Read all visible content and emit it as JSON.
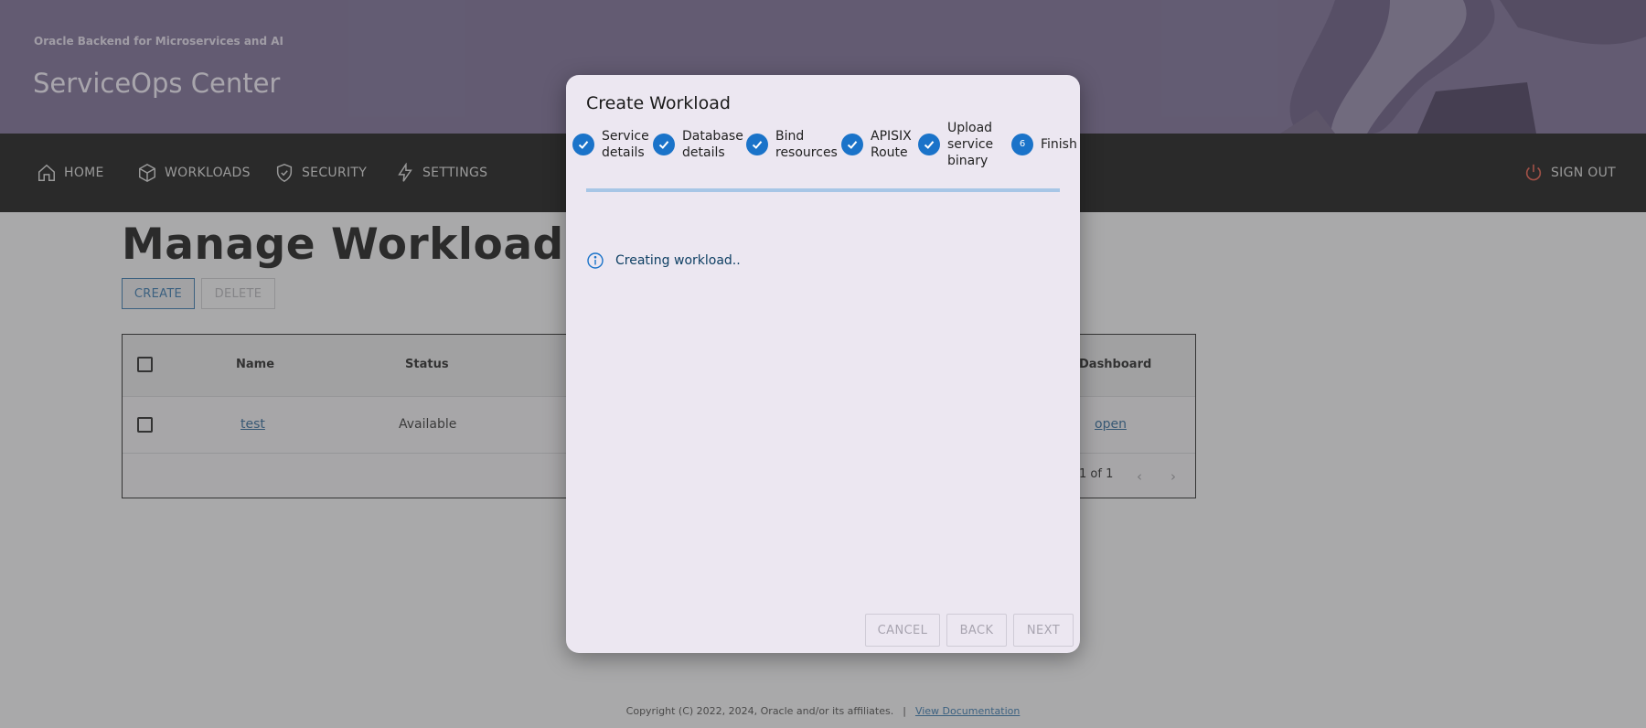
{
  "header": {
    "subtitle": "Oracle Backend for Microservices and AI",
    "title": "ServiceOps Center"
  },
  "nav": {
    "home": "HOME",
    "workloads": "WORKLOADS",
    "security": "SECURITY",
    "settings": "SETTINGS",
    "sign_out": "SIGN OUT"
  },
  "main": {
    "page_title": "Manage Workloads",
    "create_label": "CREATE",
    "delete_label": "DELETE",
    "table": {
      "headers": {
        "name": "Name",
        "status": "Status",
        "dashboard": "Dashboard"
      },
      "rows": [
        {
          "name": "test",
          "status": "Available",
          "dashboard": "open"
        }
      ],
      "pager": "1 of 1"
    }
  },
  "footer": {
    "copyright": "Copyright (C) 2022, 2024, Oracle and/or its affiliates.",
    "separator": "|",
    "doc_link": "View Documentation"
  },
  "dialog": {
    "title": "Create Workload",
    "steps": [
      {
        "line1": "Service",
        "line2": "details",
        "line3": "",
        "done": true
      },
      {
        "line1": "Database",
        "line2": "details",
        "line3": "",
        "done": true
      },
      {
        "line1": "Bind",
        "line2": "resources",
        "line3": "",
        "done": true
      },
      {
        "line1": "APISIX",
        "line2": "Route",
        "line3": "",
        "done": true
      },
      {
        "line1": "Upload",
        "line2": "service",
        "line3": "binary",
        "done": true
      },
      {
        "line1": "Finish",
        "line2": "",
        "line3": "",
        "done": false,
        "number": "6"
      }
    ],
    "info_message": "Creating workload..",
    "cancel_label": "CANCEL",
    "back_label": "BACK",
    "next_label": "NEXT"
  },
  "colors": {
    "header_bg": "#73658f",
    "nav_bg": "#0c0c0c",
    "accent": "#1a73c9",
    "sign_out_icon": "#e0503e",
    "dialog_bg": "#ece7f1"
  },
  "icons": {
    "home": "home-icon",
    "workloads": "cube-icon",
    "security": "shield-check-icon",
    "settings": "lightning-icon",
    "sign_out": "power-icon",
    "info": "info-circle-icon",
    "step_done": "check-icon"
  }
}
